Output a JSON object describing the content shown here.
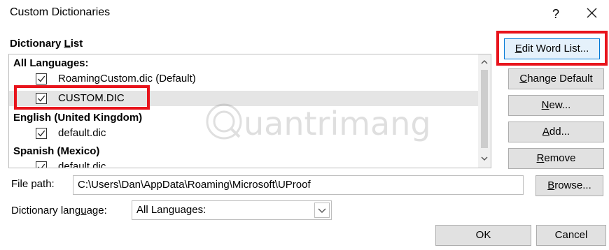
{
  "window": {
    "title": "Custom Dictionaries",
    "help_glyph": "?"
  },
  "dictionary_list": {
    "label_prefix": "Dictionary ",
    "label_underlined": "L",
    "label_suffix": "ist",
    "groups": [
      {
        "header": "All Languages:",
        "entries": [
          "RoamingCustom.dic (Default)",
          "CUSTOM.DIC"
        ]
      },
      {
        "header": "English (United Kingdom)",
        "entries": [
          "default.dic"
        ]
      },
      {
        "header": "Spanish (Mexico)",
        "entries": [
          "default.dic"
        ]
      }
    ],
    "selected_entry": "CUSTOM.DIC"
  },
  "buttons": {
    "edit_word_list": {
      "u": "E",
      "rest": "dit Word List..."
    },
    "change_default": {
      "u": "C",
      "rest": "hange Default"
    },
    "new": {
      "u": "N",
      "rest": "ew..."
    },
    "add": {
      "u": "A",
      "rest": "dd..."
    },
    "remove": {
      "u": "R",
      "rest": "emove"
    },
    "browse": {
      "u": "B",
      "rest": "rowse..."
    },
    "ok": "OK",
    "cancel": "Cancel"
  },
  "file_path": {
    "label": "File path:",
    "value": "C:\\Users\\Dan\\AppData\\Roaming\\Microsoft\\UProof"
  },
  "dictionary_language": {
    "label_prefix": "Dictionary lang",
    "label_underlined": "u",
    "label_suffix": "age:",
    "value": "All Languages:"
  },
  "watermark": {
    "text": "uantrimang"
  },
  "colors": {
    "highlight": "#e8141c",
    "selected_row": "#e5e5e5",
    "button_face": "#e1e1e1"
  },
  "icons": {
    "close": "close-icon",
    "check": "checkmark-icon",
    "scroll_up": "chevron-up-icon",
    "scroll_down": "chevron-down-icon",
    "dropdown": "chevron-down-icon"
  }
}
